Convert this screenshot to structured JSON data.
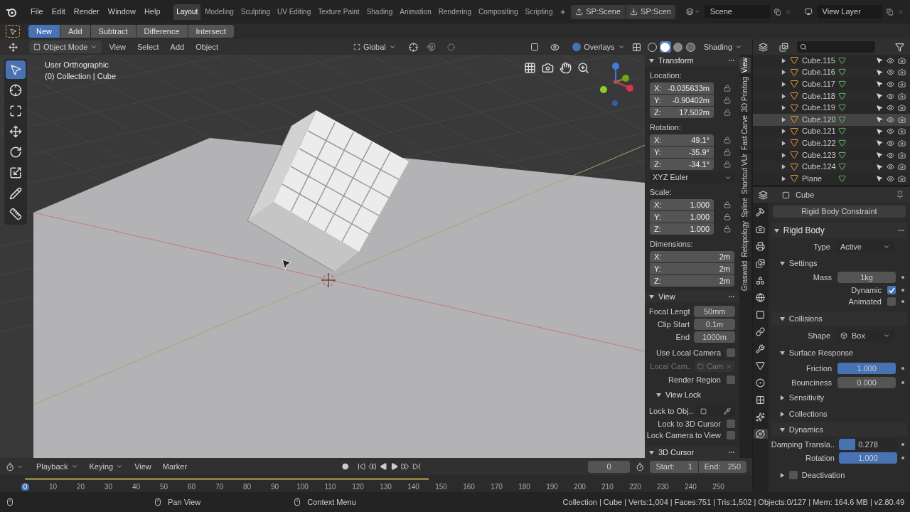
{
  "menu": [
    "File",
    "Edit",
    "Render",
    "Window",
    "Help"
  ],
  "workspaces": [
    {
      "label": "Layout",
      "selected": true
    },
    {
      "label": "Modeling",
      "selected": false
    },
    {
      "label": "Sculpting",
      "selected": false
    },
    {
      "label": "UV Editing",
      "selected": false
    },
    {
      "label": "Texture Paint",
      "selected": false
    },
    {
      "label": "Shading",
      "selected": false
    },
    {
      "label": "Animation",
      "selected": false
    },
    {
      "label": "Rendering",
      "selected": false
    },
    {
      "label": "Compositing",
      "selected": false
    },
    {
      "label": "Scripting",
      "selected": false
    }
  ],
  "scene_tools": [
    {
      "kind": "up",
      "label": "SP:Scene"
    },
    {
      "kind": "down",
      "label": "SP:Scen"
    }
  ],
  "scene": "Scene",
  "view_layer": "View Layer",
  "boolean_modes": [
    {
      "label": "New",
      "selected": true
    },
    {
      "label": "Add",
      "selected": false
    },
    {
      "label": "Subtract",
      "selected": false
    },
    {
      "label": "Difference",
      "selected": false
    },
    {
      "label": "Intersect",
      "selected": false
    }
  ],
  "viewport": {
    "mode": "Object Mode",
    "menus": [
      "View",
      "Select",
      "Add",
      "Object"
    ],
    "orientation": "Global",
    "overlays": "Overlays",
    "shading": "Shading",
    "shading_modes": [
      {
        "kind": "wireframe",
        "selected": false
      },
      {
        "kind": "solid",
        "selected": true
      },
      {
        "kind": "material",
        "selected": false
      },
      {
        "kind": "rendered",
        "selected": false
      }
    ],
    "view_name": "User Orthographic",
    "collection_info": "(0) Collection | Cube",
    "tools": [
      {
        "kind": "select",
        "selected": true
      },
      {
        "kind": "cursor",
        "selected": false
      },
      {
        "kind": "transform",
        "selected": false
      },
      {
        "kind": "move",
        "selected": false
      },
      {
        "kind": "rotate",
        "selected": false
      },
      {
        "kind": "scale",
        "selected": false
      },
      {
        "kind": "annotate",
        "selected": false
      },
      {
        "kind": "measure",
        "selected": false
      }
    ]
  },
  "sidebar": {
    "tabs": [
      {
        "label": "View",
        "selected": true
      },
      {
        "label": "3D Printing",
        "selected": false
      },
      {
        "label": "Fast Carve",
        "selected": false
      },
      {
        "label": "Shortcut VUr",
        "selected": false
      },
      {
        "label": "Spline",
        "selected": false
      },
      {
        "label": "Retopology",
        "selected": false
      },
      {
        "label": "Graswald",
        "selected": false
      }
    ],
    "transform": {
      "title": "Transform",
      "groups": [
        {
          "label": "Location:",
          "kind": "locked",
          "fields": [
            {
              "axis": "X:",
              "value": "-0.035633m"
            },
            {
              "axis": "Y:",
              "value": "-0.90402m"
            },
            {
              "axis": "Z:",
              "value": "17.502m"
            }
          ]
        },
        {
          "label": "Rotation:",
          "kind": "locked",
          "fields": [
            {
              "axis": "X:",
              "value": "49.1°"
            },
            {
              "axis": "Y:",
              "value": "-35.9°"
            },
            {
              "axis": "Z:",
              "value": "-34.1°"
            }
          ],
          "mode": "XYZ Euler"
        },
        {
          "label": "Scale:",
          "kind": "locked",
          "fields": [
            {
              "axis": "X:",
              "value": "1.000"
            },
            {
              "axis": "Y:",
              "value": "1.000"
            },
            {
              "axis": "Z:",
              "value": "1.000"
            }
          ]
        },
        {
          "label": "Dimensions:",
          "kind": "wide",
          "fields": [
            {
              "axis": "X:",
              "value": "2m"
            },
            {
              "axis": "Y:",
              "value": "2m"
            },
            {
              "axis": "Z:",
              "value": "2m"
            }
          ]
        }
      ]
    },
    "view": {
      "title": "View",
      "fields": [
        {
          "label": "Focal Lengt",
          "value": "50mm"
        },
        {
          "label": "Clip Start",
          "value": "0.1m"
        },
        {
          "label": "End",
          "value": "1000m"
        }
      ],
      "use_local_camera": {
        "label": "Use Local Camera",
        "checked": false
      },
      "local_camera": {
        "label": "Local Cam..",
        "value": "Cam",
        "disabled": true
      },
      "render_region": {
        "label": "Render Region",
        "checked": false
      },
      "view_lock": {
        "title": "View Lock",
        "expanded": true,
        "lock_to_object": "Lock to Obj..",
        "checks": [
          {
            "label": "Lock to 3D Cursor",
            "checked": false
          },
          {
            "label": "Lock Camera to View",
            "checked": false
          }
        ]
      }
    },
    "cursor_panel": "3D Cursor"
  },
  "outliner": {
    "rows": [
      {
        "name": "Cube.115",
        "selected": false
      },
      {
        "name": "Cube.116",
        "selected": false
      },
      {
        "name": "Cube.117",
        "selected": false
      },
      {
        "name": "Cube.118",
        "selected": false
      },
      {
        "name": "Cube.119",
        "selected": false
      },
      {
        "name": "Cube.120",
        "selected": true
      },
      {
        "name": "Cube.121",
        "selected": false
      },
      {
        "name": "Cube.122",
        "selected": false
      },
      {
        "name": "Cube.123",
        "selected": false
      },
      {
        "name": "Cube.124",
        "selected": false
      },
      {
        "name": "Plane",
        "selected": false
      }
    ]
  },
  "properties": {
    "object": "Cube",
    "tabs": [
      {
        "kind": "tool",
        "selected": false
      },
      {
        "kind": "render",
        "selected": false
      },
      {
        "kind": "output",
        "selected": false
      },
      {
        "kind": "view_layer",
        "selected": false
      },
      {
        "kind": "scene",
        "selected": false
      },
      {
        "kind": "world",
        "selected": false
      },
      {
        "kind": "object",
        "selected": false
      },
      {
        "kind": "constraint",
        "selected": false
      },
      {
        "kind": "modifier",
        "selected": false
      },
      {
        "kind": "data",
        "selected": false
      },
      {
        "kind": "material",
        "selected": false
      },
      {
        "kind": "texture",
        "selected": false
      },
      {
        "kind": "particles",
        "selected": false
      },
      {
        "kind": "physics",
        "selected": true
      }
    ],
    "constraint_button": "Rigid Body Constraint",
    "panel": "Rigid Body",
    "type_label": "Type",
    "type": "Active",
    "settings": {
      "title": "Settings",
      "expanded": true
    },
    "mass_label": "Mass",
    "mass": "1kg",
    "checks": [
      {
        "label": "Dynamic",
        "checked": true
      },
      {
        "label": "Animated",
        "checked": false
      }
    ],
    "collisions": {
      "title": "Collisions",
      "expanded": true
    },
    "shape_label": "Shape",
    "shape": "Box",
    "surface": {
      "title": "Surface Response",
      "expanded": true
    },
    "surface_sliders": [
      {
        "label": "Friction",
        "value": "1.000",
        "level": 1
      },
      {
        "label": "Bounciness",
        "value": "0.000",
        "level": 0
      }
    ],
    "collapsed": [
      {
        "title": "Sensitivity",
        "expanded": false
      },
      {
        "title": "Collections",
        "expanded": false
      }
    ],
    "dynamics": {
      "title": "Dynamics",
      "expanded": true
    },
    "dynamics_sliders": [
      {
        "label": "Damping Transla..",
        "value": "0.278",
        "level": 0.278
      },
      {
        "label": "Rotation",
        "value": "1.000",
        "level": 1
      }
    ],
    "deactivation": {
      "label": "Deactivation",
      "expanded": false,
      "checked": false
    }
  },
  "timeline": {
    "menus": [
      "Playback",
      "Keying",
      "View",
      "Marker"
    ],
    "current_frame": "0",
    "start_label": "Start:",
    "start": "1",
    "end_label": "End:",
    "end": "250",
    "ticks": [
      "0",
      "10",
      "20",
      "30",
      "40",
      "50",
      "60",
      "70",
      "80",
      "90",
      "100",
      "110",
      "120",
      "130",
      "140",
      "150",
      "160",
      "170",
      "180",
      "190",
      "200",
      "210",
      "220",
      "230",
      "240",
      "250"
    ]
  },
  "status": {
    "hints": [
      "Pan View",
      "Context Menu"
    ],
    "stats": "Collection | Cube | Verts:1,004 | Faces:751 | Tris:1,502 | Objects:0/127 | Mem: 164.6 MB | v2.80.49"
  }
}
